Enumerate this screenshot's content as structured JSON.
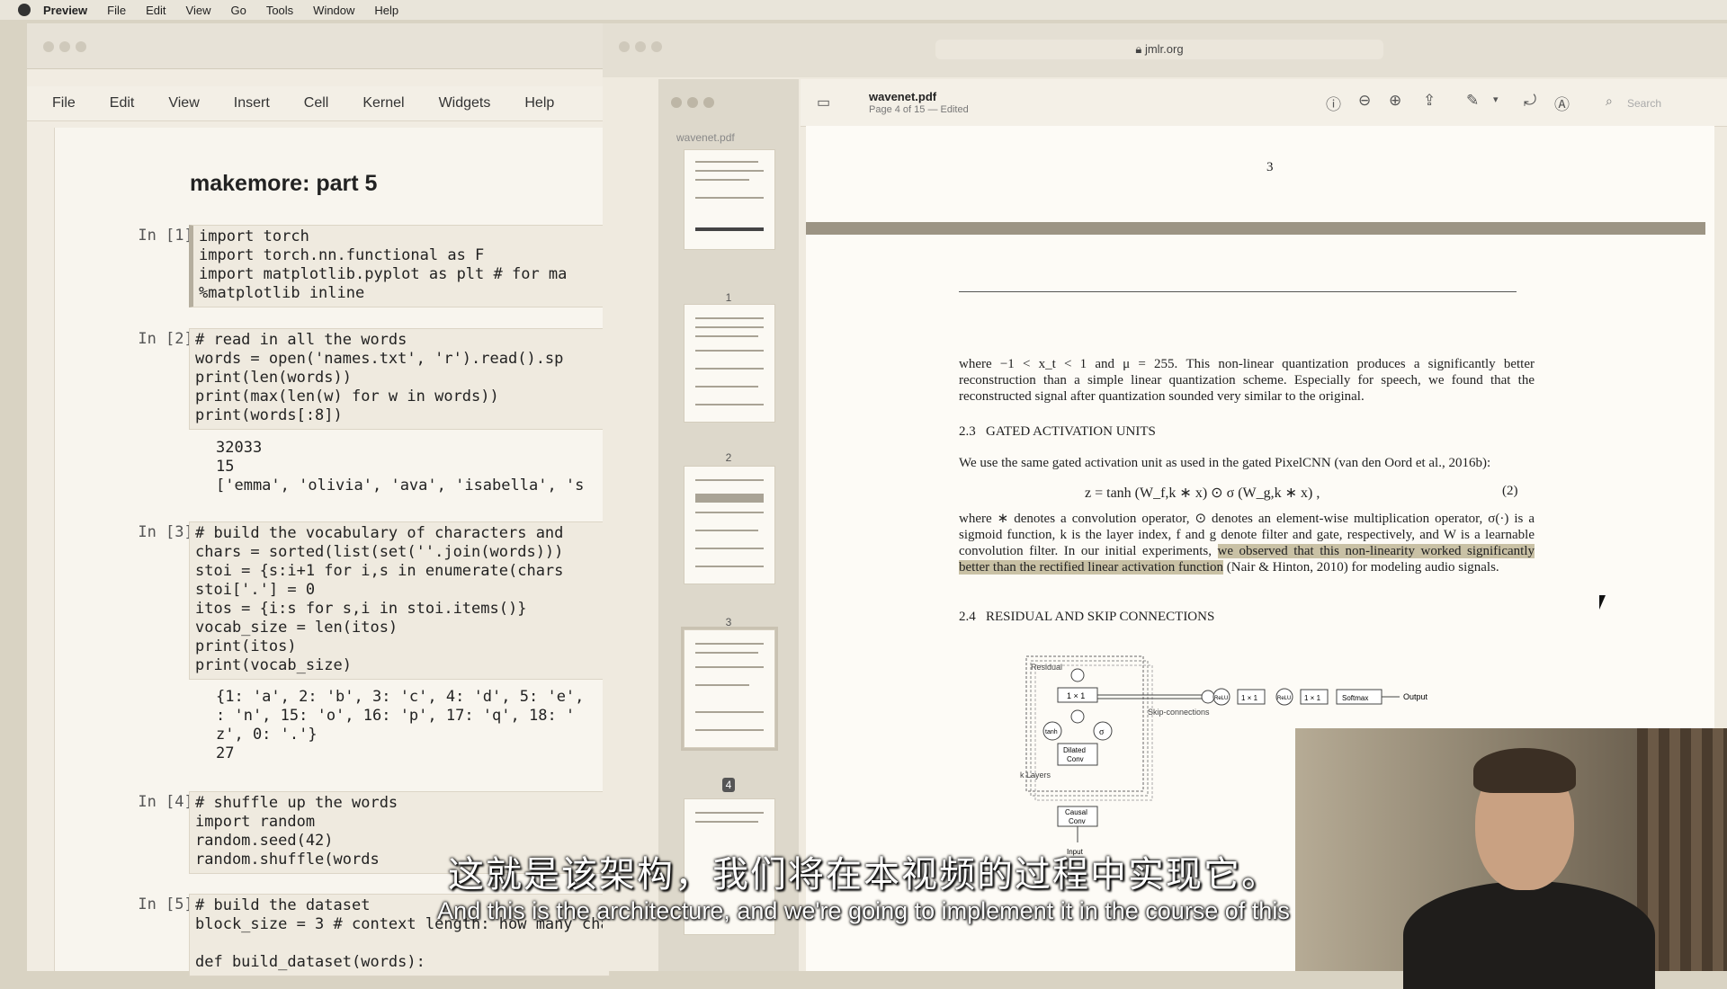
{
  "menubar": {
    "app": "Preview",
    "items": [
      "File",
      "Edit",
      "View",
      "Go",
      "Tools",
      "Window",
      "Help"
    ]
  },
  "jupyter": {
    "menu": [
      "File",
      "Edit",
      "View",
      "Insert",
      "Cell",
      "Kernel",
      "Widgets",
      "Help"
    ],
    "title": "makemore: part 5",
    "cells": [
      {
        "prompt": "In [1]:",
        "code": "import torch\nimport torch.nn.functional as F\nimport matplotlib.pyplot as plt # for ma\n%matplotlib inline",
        "output": ""
      },
      {
        "prompt": "In [2]:",
        "code": "# read in all the words\nwords = open('names.txt', 'r').read().sp\nprint(len(words))\nprint(max(len(w) for w in words))\nprint(words[:8])",
        "output": "32033\n15\n['emma', 'olivia', 'ava', 'isabella', 's"
      },
      {
        "prompt": "In [3]:",
        "code": "# build the vocabulary of characters and\nchars = sorted(list(set(''.join(words)))\nstoi = {s:i+1 for i,s in enumerate(chars\nstoi['.'] = 0\nitos = {i:s for s,i in stoi.items()}\nvocab_size = len(itos)\nprint(itos)\nprint(vocab_size)",
        "output": "{1: 'a', 2: 'b', 3: 'c', 4: 'd', 5: 'e',\n: 'n', 15: 'o', 16: 'p', 17: 'q', 18: '\nz', 0: '.'}\n27"
      },
      {
        "prompt": "In [4]:",
        "code": "# shuffle up the words\nimport random\nrandom.seed(42)\nrandom.shuffle(words",
        "output": ""
      },
      {
        "prompt": "In [5]:",
        "code": "# build the dataset\nblock_size = 3 # context length: how many characters do we take to predict the next one?\n\ndef build_dataset(words):",
        "output": ""
      }
    ]
  },
  "safari": {
    "address": "jmlr.org"
  },
  "preview": {
    "file_name": "wavenet.pdf",
    "subtitle": "Page 4 of 15 — Edited",
    "search_placeholder": "Search",
    "sidebar_title": "wavenet.pdf",
    "thumbnails": [
      "1",
      "2",
      "3",
      "4"
    ],
    "selected_page": "4"
  },
  "document": {
    "page_number": "3",
    "para1": "where −1 < x_t < 1 and μ = 255. This non-linear quantization produces a significantly better reconstruction than a simple linear quantization scheme. Especially for speech, we found that the reconstructed signal after quantization sounded very similar to the original.",
    "sec23_num": "2.3",
    "sec23_title": "GATED ACTIVATION UNITS",
    "para2": "We use the same gated activation unit as used in the gated PixelCNN (van den Oord et al., 2016b):",
    "equation": "z = tanh (W_f,k ∗ x) ⊙ σ (W_g,k ∗ x) ,",
    "equation_number": "(2)",
    "para3_pre": "where ∗ denotes a convolution operator, ⊙ denotes an element-wise multiplication operator, σ(·) is a sigmoid function, k is the layer index, f and g denote filter and gate, respectively, and W is a learnable convolution filter. In our initial experiments, ",
    "para3_hl": "we observed that this non-linearity worked significantly better than the rectified linear activation function",
    "para3_post": " (Nair & Hinton, 2010) for modeling audio signals.",
    "sec24_num": "2.4",
    "sec24_title": "RESIDUAL AND SKIP CONNECTIONS",
    "diagram": {
      "residual": "Residual",
      "conv1x1": "1 × 1",
      "tanh": "tanh",
      "sigma": "σ",
      "dilated": "Dilated",
      "conv": "Conv",
      "k_layers": "k Layers",
      "causal": "Causal",
      "causal_conv": "Conv",
      "input": "Input",
      "skip": "Skip-connections",
      "relu1": "ReLU",
      "b1": "1 × 1",
      "relu2": "ReLU",
      "b2": "1 × 1",
      "softmax": "Softmax",
      "output": "Output"
    }
  },
  "subtitles": {
    "chinese": "这就是该架构，我们将在本视频的过程中实现它。",
    "english": "And this is the architecture, and we're going to implement it in the course of this"
  }
}
